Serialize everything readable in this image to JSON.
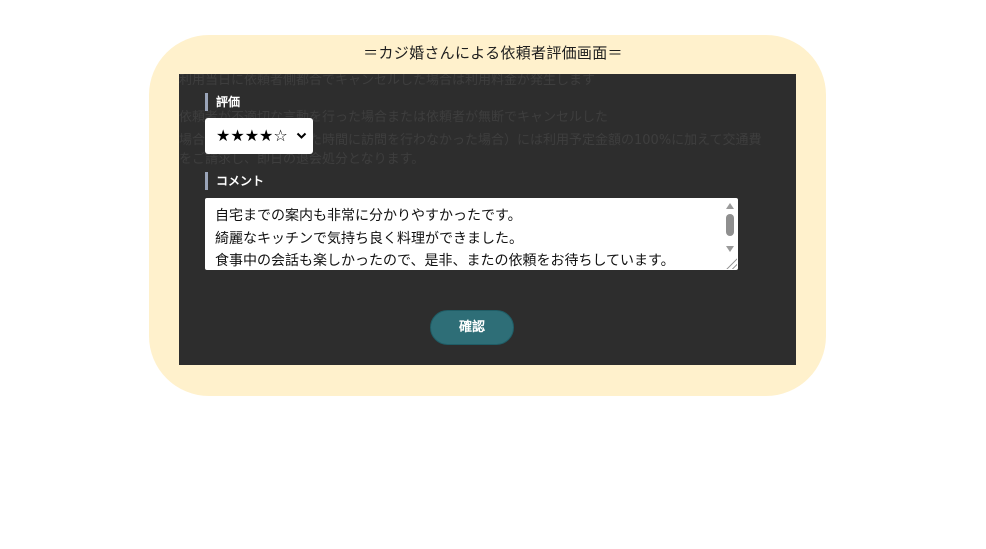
{
  "dialog": {
    "title": "＝カジ婚さんによる依頼者評価画面＝"
  },
  "background_text": {
    "lines": [
      "利用当日に依頼者側都合でキャンセルした場合は利用料金が発生します",
      "依頼者が不適切な言動を行った場合または依頼者が無断でキャンセルした",
      "場合（依頼者が指定した時間に訪問を行わなかった場合）には利用予定金額の100%に加えて交通費",
      "をご請求し、即日の退会処分となります。"
    ]
  },
  "rating": {
    "label": "評価",
    "selected": "★★★★☆",
    "chevron_icon": "chevron-down-icon"
  },
  "comment": {
    "label": "コメント",
    "lines": [
      "自宅までの案内も非常に分かりやすかったです。",
      "綺麗なキッチンで気持ち良く料理ができました。",
      "食事中の会話も楽しかったので、是非、またの依頼をお待ちしています。"
    ]
  },
  "actions": {
    "confirm_label": "確認"
  },
  "colors": {
    "card_background": "#fff1cc",
    "panel_background": "#2d2d2d",
    "button_background": "#2e6e77",
    "label_accent": "#9aa4b8"
  }
}
